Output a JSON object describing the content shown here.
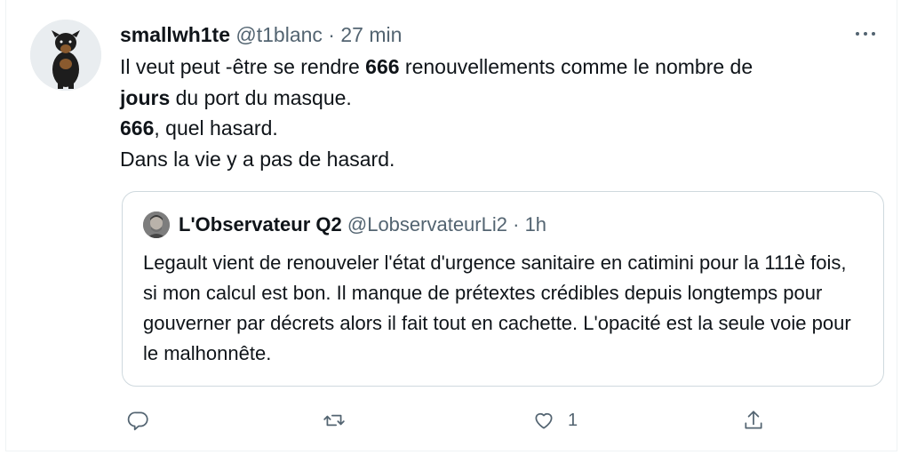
{
  "tweet": {
    "display_name": "smallwh1te",
    "handle": "@t1blanc",
    "separator": "·",
    "time": "27 min",
    "avatar_icon": "dog-avatar",
    "text": {
      "line1_a": "Il veut peut -être se rendre ",
      "line1_b": "666",
      "line1_c": " renouvellements comme le nombre de",
      "line2_a": "jours",
      "line2_b": " du port du masque.",
      "line3_a": "666",
      "line3_b": ", quel hasard.",
      "line4": "Dans la vie y a pas de hasard."
    }
  },
  "quoted": {
    "display_name": "L'Observateur Q2",
    "handle": "@LobservateurLi2",
    "separator": "·",
    "time": "1h",
    "avatar_icon": "man-avatar",
    "text": "Legault vient de renouveler l'état d'urgence sanitaire en catimini pour la 111è fois, si mon calcul est bon. Il manque de prétextes crédibles depuis longtemps pour gouverner par décrets alors il fait tout en cachette. L'opacité est la seule voie pour le malhonnête."
  },
  "actions": {
    "reply_icon": "reply-icon",
    "retweet_icon": "retweet-icon",
    "like_icon": "heart-icon",
    "like_count": "1",
    "share_icon": "share-icon"
  },
  "colors": {
    "text": "#0f1419",
    "muted": "#536471",
    "border": "#cfd9de"
  }
}
